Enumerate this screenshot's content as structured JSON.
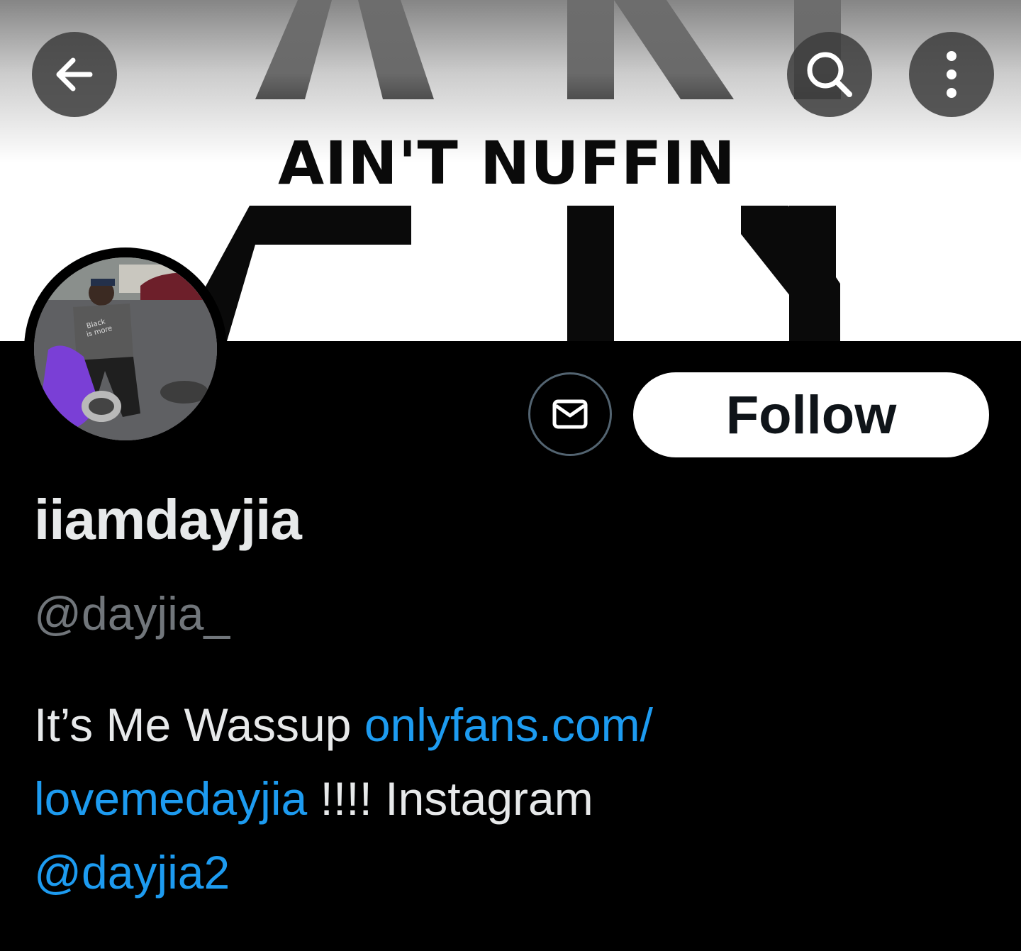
{
  "header": {
    "banner_text": "AIN'T NUFFIN",
    "back_icon": "arrow-left-icon",
    "search_icon": "search-icon",
    "more_icon": "more-vertical-icon"
  },
  "profile": {
    "display_name": "iiamdayjia",
    "handle": "@dayjia_",
    "message_icon": "envelope-icon",
    "follow_label": "Follow"
  },
  "bio": {
    "text_1": "It’s Me Wassup ",
    "link_1_part_a": "onlyfans.com/",
    "link_1_part_b": "lovemedayjia",
    "text_2": " !!!! Instagram",
    "mention": "@dayjia2"
  },
  "colors": {
    "background": "#000000",
    "link": "#1d9bf0",
    "secondary_text": "#71767b",
    "primary_text": "#e7e9ea"
  }
}
